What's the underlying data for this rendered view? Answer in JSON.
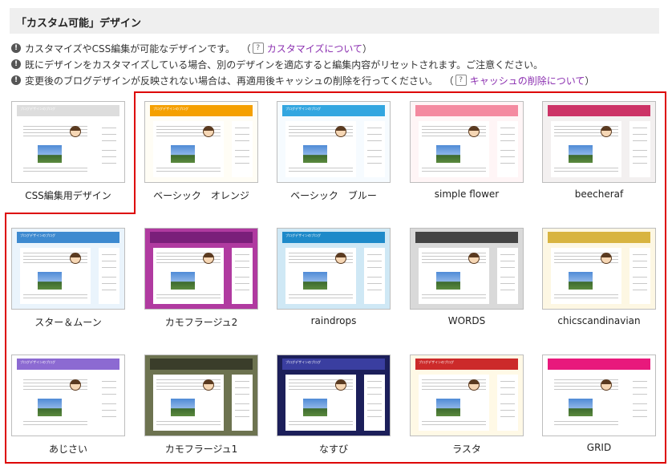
{
  "header": {
    "title": "「カスタム可能」デザイン"
  },
  "notes": [
    {
      "text": "カスタマイズやCSS編集が可能なデザインです。",
      "link": "カスタマイズについて"
    },
    {
      "text": "既にデザインをカスタマイズしている場合、別のデザインを適応すると編集内容がリセットされます。ご注意ください。",
      "link": ""
    },
    {
      "text": "変更後のブログデザインが反映されない場合は、再適用後キャッシュの削除を行ってください。",
      "link": "キャッシュの削除について"
    }
  ],
  "colors": {
    "highlight": "#dd0000",
    "link": "#8b2fb0"
  },
  "designs": [
    {
      "label": "CSS編集用デザイン",
      "bg": "#ffffff",
      "accent": "#dddddd",
      "blog_title": "ブログデザインのブログ"
    },
    {
      "label": "ベーシック　オレンジ",
      "bg": "#fffdf5",
      "accent": "#f5a000",
      "blog_title": "ブログデザインのブログ"
    },
    {
      "label": "ベーシック　ブルー",
      "bg": "#f6fbff",
      "accent": "#33a6e0",
      "blog_title": "ブログデザインのブログ"
    },
    {
      "label": "simple flower",
      "bg": "#fff5f6",
      "accent": "#f48aa0",
      "blog_title": ""
    },
    {
      "label": "beecheraf",
      "bg": "#f3f0f0",
      "accent": "#cc3366",
      "blog_title": ""
    },
    {
      "label": "スター＆ムーン",
      "bg": "#eaf4fc",
      "accent": "#3d8ad0",
      "blog_title": "ブログデザインのブログ"
    },
    {
      "label": "カモフラージュ2",
      "bg": "#b03aa0",
      "accent": "#7a1f7a",
      "blog_title": ""
    },
    {
      "label": "raindrops",
      "bg": "#cfe8f5",
      "accent": "#1e8ac9",
      "blog_title": "ブログデザインのブログ"
    },
    {
      "label": "WORDS",
      "bg": "#d9d9d9",
      "accent": "#444444",
      "blog_title": ""
    },
    {
      "label": "chicscandinavian",
      "bg": "#fdf7e3",
      "accent": "#d8b440",
      "blog_title": ""
    },
    {
      "label": "あじさい",
      "bg": "#ffffff",
      "accent": "#8c6ad2",
      "blog_title": "ブログデザインのブログ"
    },
    {
      "label": "カモフラージュ1",
      "bg": "#6d7350",
      "accent": "#3a3d2a",
      "blog_title": ""
    },
    {
      "label": "なすび",
      "bg": "#1c1f5a",
      "accent": "#3a3ea0",
      "blog_title": "ブログデザインのブログ"
    },
    {
      "label": "ラスタ",
      "bg": "#fff9e6",
      "accent": "#cc2a2a",
      "blog_title": "ブログデザインのブログ"
    },
    {
      "label": "GRID",
      "bg": "#ffffff",
      "accent": "#e8197c",
      "blog_title": ""
    }
  ]
}
